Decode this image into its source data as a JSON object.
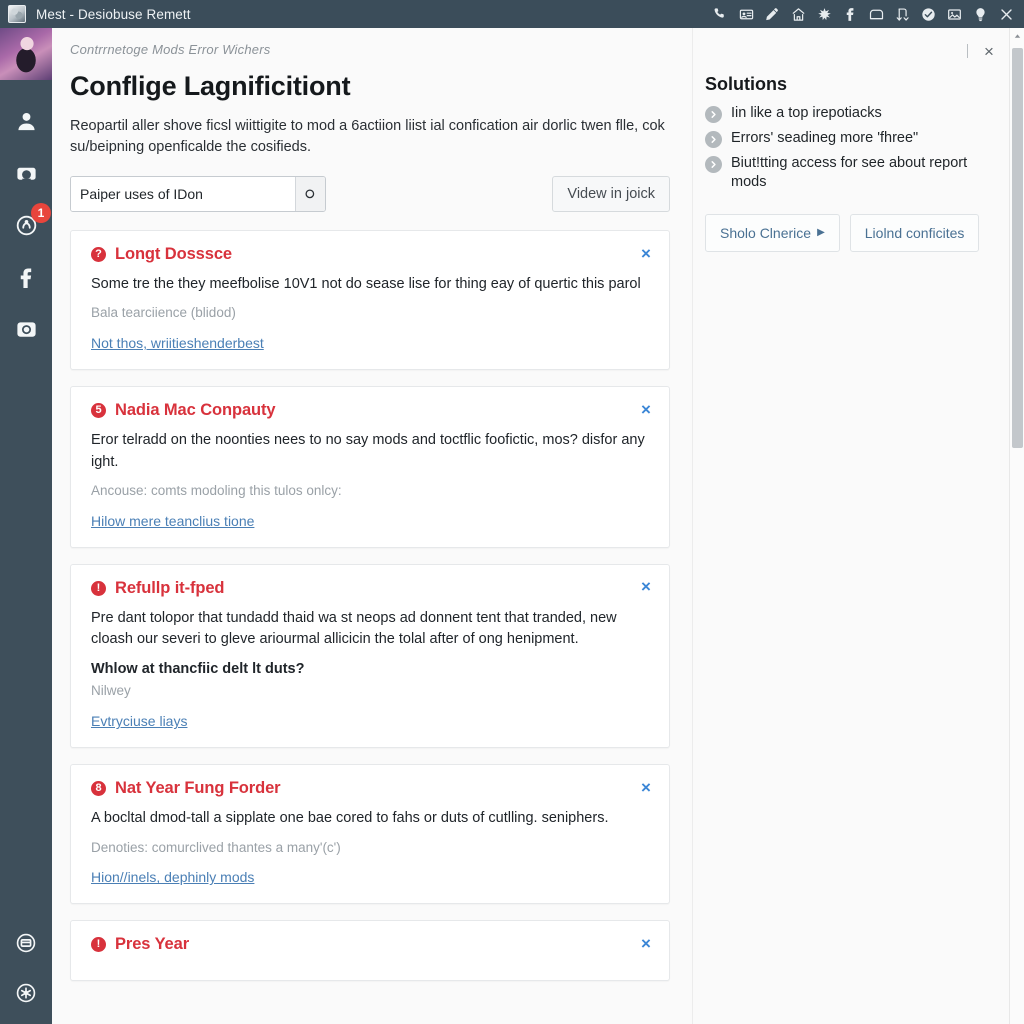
{
  "window": {
    "title": "Mest - Desiobuse Remett",
    "favicon_icon": "app-icon",
    "titlebar_icons": [
      "phone-icon",
      "id-card-icon",
      "pencil-icon",
      "home-icon",
      "asterisk-icon",
      "facebook-icon",
      "folder-icon",
      "anchor-icon",
      "check-circle-icon",
      "image-icon",
      "bulb-icon",
      "close-icon"
    ]
  },
  "rail": {
    "avatar_name": "user-avatar",
    "items": [
      {
        "name": "user-icon",
        "badge": null
      },
      {
        "name": "printer-icon",
        "badge": null
      },
      {
        "name": "notifications-icon",
        "badge": "1"
      },
      {
        "name": "facebook-icon",
        "badge": null
      },
      {
        "name": "camera-icon",
        "badge": null
      }
    ],
    "bottom_items": [
      {
        "name": "inbox-icon"
      },
      {
        "name": "settings-icon"
      }
    ]
  },
  "main": {
    "breadcrumb": "Contrrnetoge Mods Error Wichers",
    "title": "Conflige Lagnificitiont",
    "description": "Reopartil aller shove ficsl wiittigite to mod a 6actiion liist ial confication air dorlic twen flle, cok su/beipning openficalde the cosifieds.",
    "search": {
      "value": "Paiper uses of IDon",
      "placeholder": "Paiper uses of IDon",
      "button_icon": "search-icon"
    },
    "view_button": "Videw in joick",
    "cards": [
      {
        "title": "Longt Dosssce",
        "icon": "error-icon",
        "icon_glyph": "?",
        "body": "Some tre the they meefbolise 10V1 not do sease lise for thing eay of quertic this parol",
        "strong": null,
        "sub": "Bala tearciience (blidod)",
        "link": "Not thos, wriitieshenderbest",
        "close_icon": "close-icon"
      },
      {
        "title": "Nadia Mac Conpauty",
        "icon": "error-icon",
        "icon_glyph": "5",
        "body": "Eror telradd on the noonties nees to no say mods and toctflic foofictic, mos? disfor any ight.",
        "strong": null,
        "sub": "Ancouse: comts modoling this tulos onlcy:",
        "link": "Hilow mere teanclius tione",
        "close_icon": "close-icon"
      },
      {
        "title": "Refullp it-fped",
        "icon": "error-icon",
        "icon_glyph": "!",
        "body": "Pre dant tolopor that tundadd thaid wa st neops ad donnent tent that tranded, new cloash our severi to gleve ariourmal allicicin the tolal after of ong henipment.",
        "strong": "Whlow at thancfiic delt lt duts?",
        "sub": "Nilwey",
        "link": "Evtryciuse liays",
        "close_icon": "close-icon"
      },
      {
        "title": "Nat Year Fung Forder",
        "icon": "error-icon",
        "icon_glyph": "8",
        "body": "A bocltal dmod-tall a sipplate one bae cored to fahs or duts of cutlling. seniphers.",
        "strong": null,
        "sub": "Denoties: comurclived thantes a many'(c')",
        "link": "Hion//inels, dephinly mods",
        "close_icon": "close-icon"
      },
      {
        "title": "Pres Year",
        "icon": "error-icon",
        "icon_glyph": "!",
        "body": null,
        "strong": null,
        "sub": null,
        "link": null,
        "close_icon": "close-icon"
      }
    ]
  },
  "side": {
    "separator": "|",
    "close_icon": "close-icon",
    "title": "Solutions",
    "solutions": [
      {
        "icon": "chevron-right-icon",
        "text": "Iin like a top irepotiacks"
      },
      {
        "icon": "chevron-right-icon",
        "text": "Errors' seadineg more 'fhree\""
      },
      {
        "icon": "chevron-right-icon",
        "text": "Biut!tting access for see about report mods"
      }
    ],
    "buttons": [
      {
        "label": "Sholo Clnerice",
        "caret": "▶"
      },
      {
        "label": "Liolnd conficites",
        "caret": ""
      }
    ]
  },
  "scrollbar": {
    "up_arrow_icon": "caret-up-icon"
  },
  "colors": {
    "titlebar": "#3b4d5a",
    "rail": "#3e4f5b",
    "error_red": "#d8323c",
    "badge_red": "#e8453c",
    "link_blue": "#4a7fb5",
    "close_blue": "#3b86d6"
  }
}
